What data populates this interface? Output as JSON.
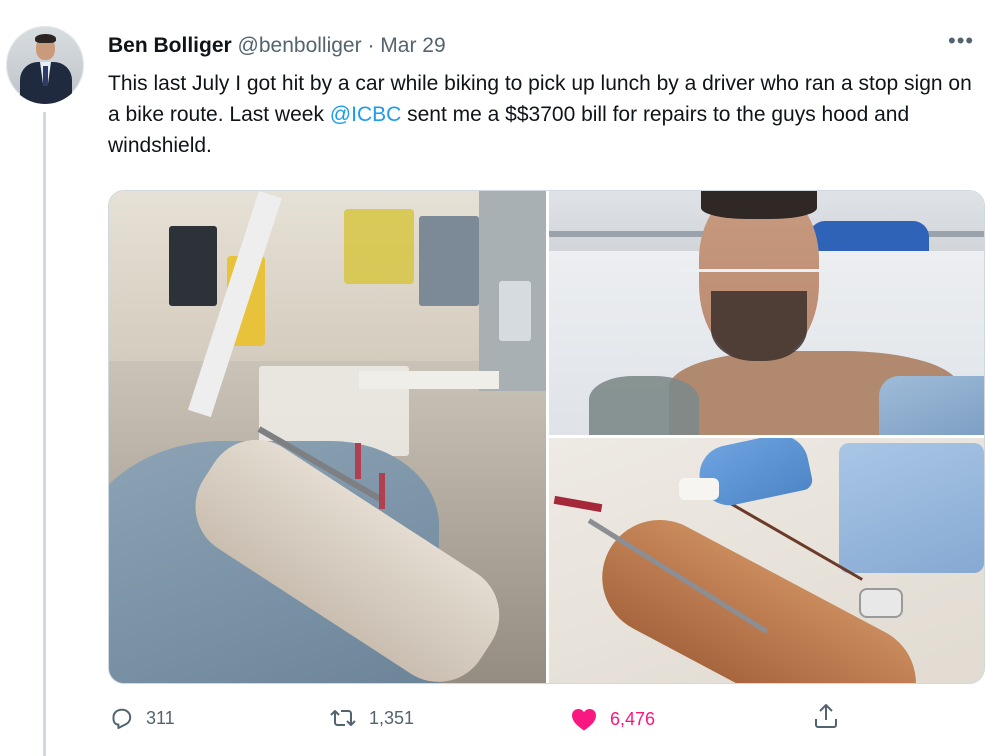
{
  "tweet": {
    "author_name": "Ben Bolliger",
    "handle": "@benbolliger",
    "separator": "·",
    "date": "Mar 29",
    "text_part1": "This last July I got hit by a car while biking to pick up lunch by a driver who ran a stop sign on a bike route.  Last week ",
    "mention": "@ICBC",
    "text_part2": " sent me a $$3700 bill for repairs to the guys hood and windshield."
  },
  "actions": {
    "reply_count": "311",
    "retweet_count": "1,351",
    "like_count": "6,476"
  },
  "colors": {
    "accent": "#1d9bf0",
    "like": "#f91880",
    "muted": "#536471"
  },
  "icons": [
    "more-icon",
    "reply-icon",
    "retweet-icon",
    "heart-icon",
    "share-icon"
  ]
}
